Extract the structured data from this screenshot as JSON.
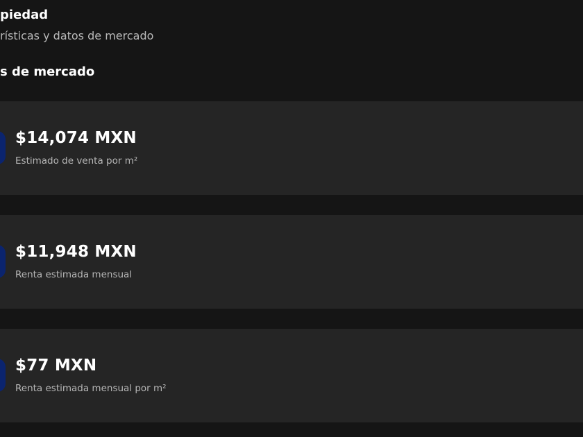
{
  "header": {
    "title": "piedad",
    "subtitle": "rísticas y datos de mercado"
  },
  "section": {
    "title": "s de mercado"
  },
  "cards": [
    {
      "value": "$14,074 MXN",
      "label": "Estimado de venta por m²",
      "icon": "market-icon"
    },
    {
      "value": "$11,948 MXN",
      "label": "Renta estimada mensual",
      "icon": "rent-icon"
    },
    {
      "value": "$77 MXN",
      "label": "Renta estimada mensual por m²",
      "icon": "rent-per-m2-icon"
    }
  ],
  "colors": {
    "background": "#151515",
    "card": "#252525",
    "icon_tile": "#0b246e",
    "text_primary": "#ffffff",
    "text_secondary": "#b7b7b7"
  }
}
